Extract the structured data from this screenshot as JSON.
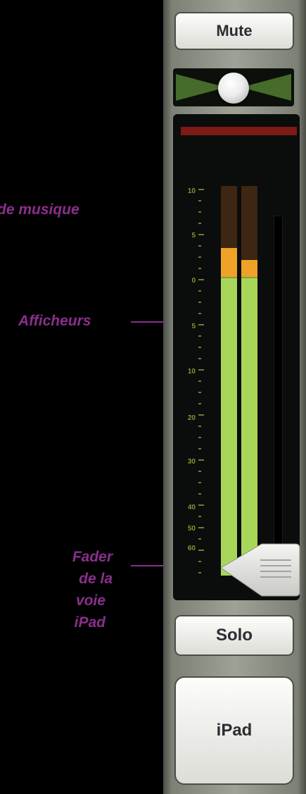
{
  "annotations": {
    "music_label": "de musique",
    "meters_label": "Afficheurs",
    "fader_label_lines": [
      "Fader",
      "de la",
      "voie",
      "iPad"
    ]
  },
  "strip": {
    "mute_label": "Mute",
    "solo_label": "Solo",
    "channel_name": "iPad",
    "pan_value": 0,
    "meter_scale": [
      "10",
      "5",
      "0",
      "5",
      "10",
      "20",
      "30",
      "40",
      "50",
      "60"
    ],
    "meter_levels": {
      "left": 0.84,
      "right": 0.81
    },
    "fader_level": 0.0
  },
  "colors": {
    "annotation": "#8a2f8c",
    "meter_green": "#a8d659",
    "meter_orange": "#f0a128",
    "clip_red": "#7d1a14"
  }
}
